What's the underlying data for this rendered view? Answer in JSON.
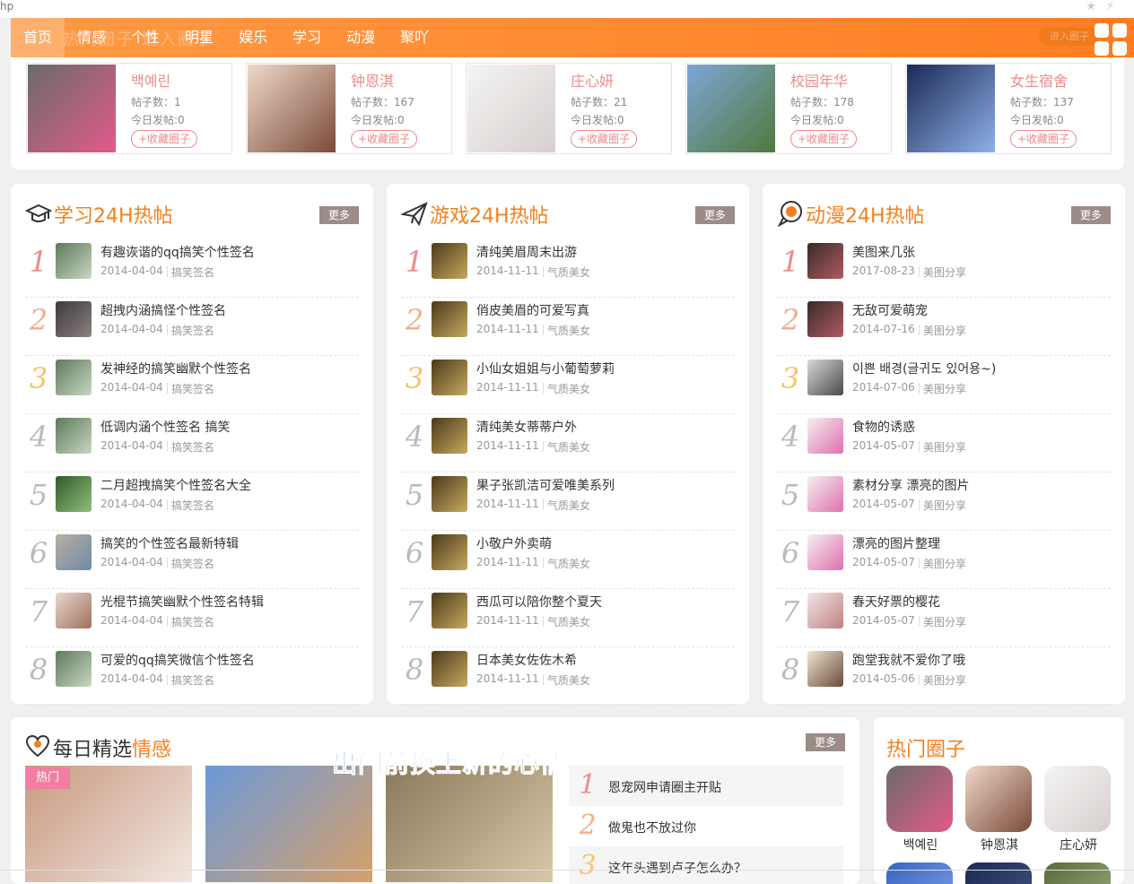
{
  "browser": {
    "url_fragment": "hp",
    "star_icon": "star-icon",
    "extension_icon": "lightning-icon"
  },
  "nav": {
    "ghost_text": "热门圈子 进入圈子",
    "items": [
      {
        "label": "首页"
      },
      {
        "label": "情感"
      },
      {
        "label": "个性"
      },
      {
        "label": "明星"
      },
      {
        "label": "娱乐"
      },
      {
        "label": "学习"
      },
      {
        "label": "动漫"
      },
      {
        "label": "聚吖"
      }
    ],
    "enter_label": "进入圈子",
    "grid_icon": "grid-menu-icon"
  },
  "featured_circles": [
    {
      "name": "백예린",
      "posts": "帖子数：1",
      "today": "今日发帖:0",
      "fav": "+收藏圈子",
      "c1": "#6b6b6b",
      "c2": "#e25a8b"
    },
    {
      "name": "钟恩淇",
      "posts": "帖子数：167",
      "today": "今日发帖:0",
      "fav": "+收藏圈子",
      "c1": "#f0d9c8",
      "c2": "#7a4a3a"
    },
    {
      "name": "庄心妍",
      "posts": "帖子数：21",
      "today": "今日发帖:0",
      "fav": "+收藏圈子",
      "c1": "#f4f4f2",
      "c2": "#d7cfcf"
    },
    {
      "name": "校园年华",
      "posts": "帖子数：178",
      "today": "今日发帖:0",
      "fav": "+收藏圈子",
      "c1": "#7ea6d6",
      "c2": "#4f7a3a"
    },
    {
      "name": "女生宿舍",
      "posts": "帖子数：137",
      "today": "今日发帖:0",
      "fav": "+收藏圈子",
      "c1": "#1a2a55",
      "c2": "#8fb0e8"
    }
  ],
  "panels": [
    {
      "title": "学习24H热帖",
      "more": "更多",
      "icon": "graduation-cap-icon",
      "rows": [
        {
          "rank": "1",
          "title": "有趣诙谐的qq搞笑个性签名",
          "date": "2014-04-04",
          "cat": "搞笑签名",
          "c1": "#5d7a5a",
          "c2": "#c9d6c2"
        },
        {
          "rank": "2",
          "title": "超拽内涵搞怪个性签名",
          "date": "2014-04-04",
          "cat": "搞笑签名",
          "c1": "#3e3a3a",
          "c2": "#8a8080"
        },
        {
          "rank": "3",
          "title": "发神经的搞笑幽默个性签名",
          "date": "2014-04-04",
          "cat": "搞笑签名",
          "c1": "#5d7a5a",
          "c2": "#c9d6c2"
        },
        {
          "rank": "4",
          "title": "低调内涵个性签名 搞笑",
          "date": "2014-04-04",
          "cat": "搞笑签名",
          "c1": "#5d7a5a",
          "c2": "#c9d6c2"
        },
        {
          "rank": "5",
          "title": "二月超拽搞笑个性签名大全",
          "date": "2014-04-04",
          "cat": "搞笑签名",
          "c1": "#2e5a2a",
          "c2": "#8fc07a"
        },
        {
          "rank": "6",
          "title": "搞笑的个性签名最新特辑",
          "date": "2014-04-04",
          "cat": "搞笑签名",
          "c1": "#b7b0a0",
          "c2": "#6f8aa8"
        },
        {
          "rank": "7",
          "title": "光棍节搞笑幽默个性签名特辑",
          "date": "2014-04-04",
          "cat": "搞笑签名",
          "c1": "#e6d8cc",
          "c2": "#a07060"
        },
        {
          "rank": "8",
          "title": "可爱的qq搞笑微信个性签名",
          "date": "2014-04-04",
          "cat": "搞笑签名",
          "c1": "#5d7a5a",
          "c2": "#c9d6c2"
        }
      ]
    },
    {
      "title": "游戏24H热帖",
      "more": "更多",
      "icon": "paper-plane-icon",
      "rows": [
        {
          "rank": "1",
          "title": "清纯美眉周末出游",
          "date": "2014-11-11",
          "cat": "气质美女",
          "c1": "#4a3a1a",
          "c2": "#c8a860"
        },
        {
          "rank": "2",
          "title": "俏皮美眉的可爱写真",
          "date": "2014-11-11",
          "cat": "气质美女",
          "c1": "#4a3a1a",
          "c2": "#c8a860"
        },
        {
          "rank": "3",
          "title": "小仙女姐姐与小葡萄萝莉",
          "date": "2014-11-11",
          "cat": "气质美女",
          "c1": "#4a3a1a",
          "c2": "#c8a860"
        },
        {
          "rank": "4",
          "title": "清纯美女蒂蒂户外",
          "date": "2014-11-11",
          "cat": "气质美女",
          "c1": "#4a3a1a",
          "c2": "#c8a860"
        },
        {
          "rank": "5",
          "title": "果子张凯洁可爱唯美系列",
          "date": "2014-11-11",
          "cat": "气质美女",
          "c1": "#4a3a1a",
          "c2": "#c8a860"
        },
        {
          "rank": "6",
          "title": "小敬户外卖萌",
          "date": "2014-11-11",
          "cat": "气质美女",
          "c1": "#4a3a1a",
          "c2": "#c8a860"
        },
        {
          "rank": "7",
          "title": "西瓜可以陪你整个夏天",
          "date": "2014-11-11",
          "cat": "气质美女",
          "c1": "#4a3a1a",
          "c2": "#c8a860"
        },
        {
          "rank": "8",
          "title": "日本美女佐佐木希",
          "date": "2014-11-11",
          "cat": "气质美女",
          "c1": "#4a3a1a",
          "c2": "#c8a860"
        }
      ]
    },
    {
      "title": "动漫24H热帖",
      "more": "更多",
      "icon": "speech-bubble-icon",
      "rows": [
        {
          "rank": "1",
          "title": "美图来几张",
          "date": "2017-08-23",
          "cat": "美图分享",
          "c1": "#3a2a2a",
          "c2": "#b05a60"
        },
        {
          "rank": "2",
          "title": "无敌可爱萌宠",
          "date": "2014-07-16",
          "cat": "美图分享",
          "c1": "#3a2a2a",
          "c2": "#b05a60"
        },
        {
          "rank": "3",
          "title": "이쁜 배경(글귀도 있어용~)",
          "date": "2014-07-06",
          "cat": "美图分享",
          "c1": "#d8d8d8",
          "c2": "#4a4a4a"
        },
        {
          "rank": "4",
          "title": "食物的诱惑",
          "date": "2014-05-07",
          "cat": "美图分享",
          "c1": "#f4f0f0",
          "c2": "#e070b0"
        },
        {
          "rank": "5",
          "title": "素材分享 漂亮的图片",
          "date": "2014-05-07",
          "cat": "美图分享",
          "c1": "#f4f0f0",
          "c2": "#e070b0"
        },
        {
          "rank": "6",
          "title": "漂亮的图片整理",
          "date": "2014-05-07",
          "cat": "美图分享",
          "c1": "#f4f0f0",
          "c2": "#e070b0"
        },
        {
          "rank": "7",
          "title": "春天好票的樱花",
          "date": "2014-05-07",
          "cat": "美图分享",
          "c1": "#f0e6e8",
          "c2": "#c08080"
        },
        {
          "rank": "8",
          "title": "跑堂我就不爱你了哦",
          "date": "2014-05-06",
          "cat": "美图分享",
          "c1": "#efe6d0",
          "c2": "#6a4a3a"
        }
      ]
    }
  ],
  "daily": {
    "title_main": "每日精选",
    "title_hl": "情感",
    "more": "更多",
    "icon": "heart-pin-icon",
    "hot_badge": "热门",
    "overlay_text": "出门前换上新的心情",
    "pics": [
      {
        "c1": "#c89a80",
        "c2": "#f2e6e0"
      },
      {
        "c1": "#6a9ad8",
        "c2": "#d7a06a"
      },
      {
        "c1": "#8a7a5a",
        "c2": "#d8c8a8"
      }
    ],
    "news": [
      {
        "rank": "1",
        "title": "恩宠网申请圈主开贴"
      },
      {
        "rank": "2",
        "title": "做鬼也不放过你"
      },
      {
        "rank": "3",
        "title": "这年头遇到卢子怎么办？"
      }
    ]
  },
  "hot_circles": {
    "title": "热门圈子",
    "items": [
      {
        "name": "백예린",
        "c1": "#6b6b6b",
        "c2": "#e25a8b"
      },
      {
        "name": "钟恩淇",
        "c1": "#f0d9c8",
        "c2": "#7a4a3a"
      },
      {
        "name": "庄心妍",
        "c1": "#f4f4f2",
        "c2": "#d7cfcf"
      }
    ],
    "row2": [
      {
        "c1": "#3a66c0",
        "c2": "#6a90e0"
      },
      {
        "c1": "#1a2a55",
        "c2": "#3a4a75"
      },
      {
        "c1": "#5a6a3a",
        "c2": "#8a9a6a"
      }
    ]
  }
}
